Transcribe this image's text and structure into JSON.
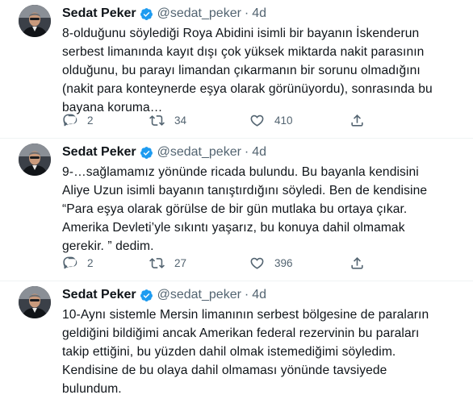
{
  "colors": {
    "text": "#0f1419",
    "secondary": "#536471",
    "verified": "#1d9bf0",
    "divider": "#eff3f4"
  },
  "icons": [
    "verified-badge-icon",
    "reply-icon",
    "retweet-icon",
    "like-icon",
    "share-icon"
  ],
  "tweets": [
    {
      "author": "Sedat Peker",
      "handle": "@sedat_peker",
      "separator": "·",
      "time": "4d",
      "lines": [
        "8-olduğunu söylediği Roya Abidini isimli bir bayanın İskenderun",
        "serbest limanında kayıt dışı çok yüksek miktarda nakit parasının",
        "olduğunu, bu parayı limandan çıkarmanın bir sorunu olmadığını",
        "(nakit para konteynerde eşya olarak görünüyordu), sonrasında bu",
        "bayana koruma…"
      ],
      "replies": "2",
      "retweets": "34",
      "likes": "410"
    },
    {
      "author": "Sedat Peker",
      "handle": "@sedat_peker",
      "separator": "·",
      "time": "4d",
      "lines": [
        "9-…sağlamamız yönünde ricada bulundu. Bu bayanla kendisini",
        "Aliye Uzun isimli bayanın tanıştırdığını söyledi. Ben de kendisine",
        "“Para eşya olarak görülse de bir gün mutlaka bu ortaya çıkar.",
        "Amerika Devleti’yle sıkıntı yaşarız, bu konuya dahil olmamak",
        "gerekir. ” dedim."
      ],
      "replies": "2",
      "retweets": "27",
      "likes": "396"
    },
    {
      "author": "Sedat Peker",
      "handle": "@sedat_peker",
      "separator": "·",
      "time": "4d",
      "lines": [
        "10-Aynı sistemle Mersin limanının serbest bölgesine de paraların",
        "geldiğini bildiğimi ancak Amerikan federal rezervinin bu paraları",
        "takip ettiğini, bu yüzden dahil olmak istemediğimi söyledim.",
        "Kendisine de bu olaya dahil olmaması yönünde tavsiyede",
        "bulundum."
      ]
    }
  ]
}
